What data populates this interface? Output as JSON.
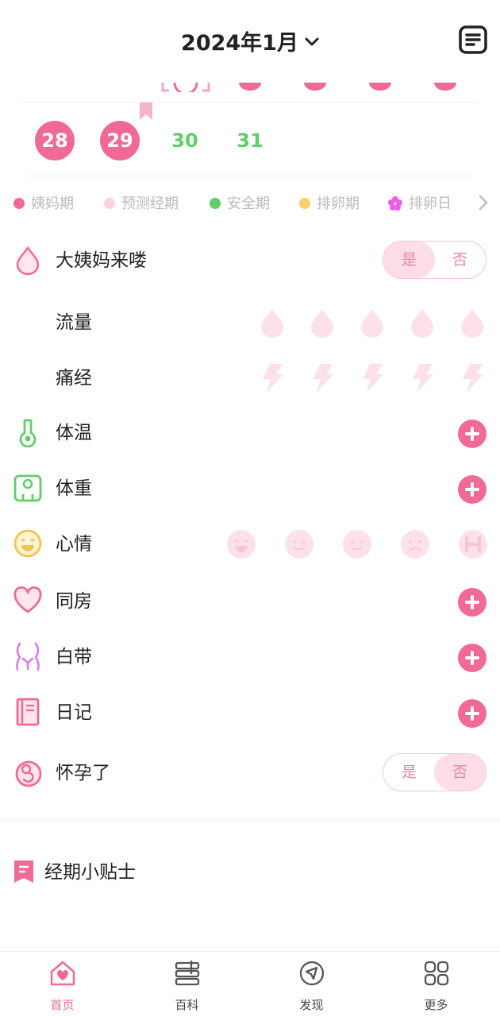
{
  "header": {
    "title": "2024年1月",
    "note_icon": "note-list-icon"
  },
  "calendar": {
    "last_week": [
      {
        "day": "28",
        "status": "period"
      },
      {
        "day": "29",
        "status": "period"
      },
      {
        "day": "30",
        "status": "safe"
      },
      {
        "day": "31",
        "status": "safe"
      }
    ]
  },
  "legend": {
    "items": [
      {
        "label": "姨妈期",
        "color": "#f06a95"
      },
      {
        "label": "预测经期",
        "color": "#fbd3df"
      },
      {
        "label": "安全期",
        "color": "#5fcf67"
      },
      {
        "label": "排卵期",
        "color": "#ffcf6b"
      },
      {
        "label": "排卵日",
        "color": "#ee5de8"
      }
    ]
  },
  "records": {
    "period": {
      "label": "大姨妈来喽",
      "yes": "是",
      "no": "否",
      "selected": "是"
    },
    "flow": {
      "label": "流量",
      "level": 0
    },
    "cramps": {
      "label": "痛经",
      "level": 0
    },
    "temperature": {
      "label": "体温"
    },
    "weight": {
      "label": "体重"
    },
    "mood": {
      "label": "心情"
    },
    "intimacy": {
      "label": "同房"
    },
    "discharge": {
      "label": "白带"
    },
    "diary": {
      "label": "日记"
    },
    "pregnant": {
      "label": "怀孕了",
      "yes": "是",
      "no": "否",
      "selected": "否"
    }
  },
  "tips": {
    "label": "经期小贴士"
  },
  "tabbar": {
    "tabs": [
      {
        "label": "首页",
        "icon": "home-heart-icon",
        "active": true
      },
      {
        "label": "百科",
        "icon": "encyclopedia-icon",
        "active": false
      },
      {
        "label": "发现",
        "icon": "compass-icon",
        "active": false
      },
      {
        "label": "更多",
        "icon": "grid-icon",
        "active": false
      }
    ]
  },
  "colors": {
    "accent": "#f06a95",
    "safe": "#5fcf67",
    "light_pink": "#fcdde8"
  }
}
